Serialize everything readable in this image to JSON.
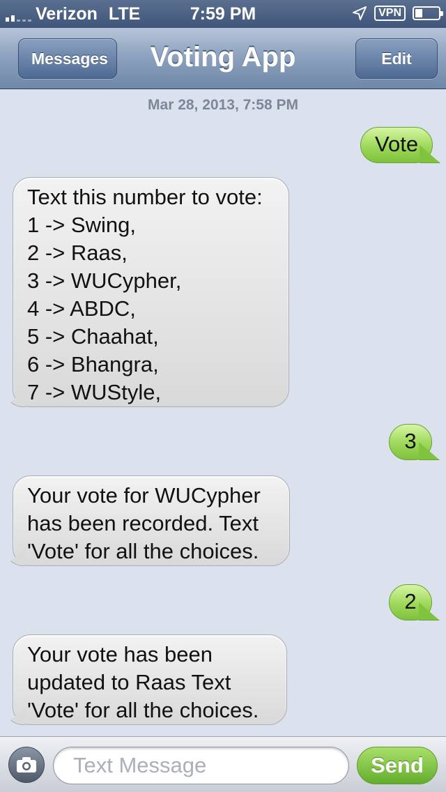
{
  "status_bar": {
    "carrier": "Verizon",
    "network": "LTE",
    "time": "7:59 PM",
    "vpn": "VPN",
    "signal_bars": 2,
    "battery_level": 0.3
  },
  "nav": {
    "title": "Voting App",
    "back_label": "Messages",
    "edit_label": "Edit"
  },
  "conversation": {
    "timestamp": "Mar 28, 2013, 7:58 PM",
    "messages": [
      {
        "direction": "outgoing",
        "text": "Vote"
      },
      {
        "direction": "incoming",
        "text": "Text this number to vote:\n1 -> Swing,\n2 -> Raas,\n3 -> WUCypher,\n4 -> ABDC,\n5 -> Chaahat,\n6 -> Bhangra,\n7 -> WUStyle,"
      },
      {
        "direction": "outgoing",
        "text": "3"
      },
      {
        "direction": "incoming",
        "text": "Your vote for WUCypher\nhas been recorded. Text\n'Vote' for all the choices."
      },
      {
        "direction": "outgoing",
        "text": "2"
      },
      {
        "direction": "incoming",
        "text": "Your vote has been\nupdated to Raas Text\n'Vote' for all the choices."
      }
    ]
  },
  "input_bar": {
    "placeholder": "Text Message",
    "value": "",
    "send_label": "Send",
    "camera_icon": "camera-icon"
  },
  "colors": {
    "outgoing_bubble": "#9ed85a",
    "incoming_bubble": "#e6e6e6",
    "nav_bar": "#8aa0bd",
    "background": "#dbe2ed"
  }
}
